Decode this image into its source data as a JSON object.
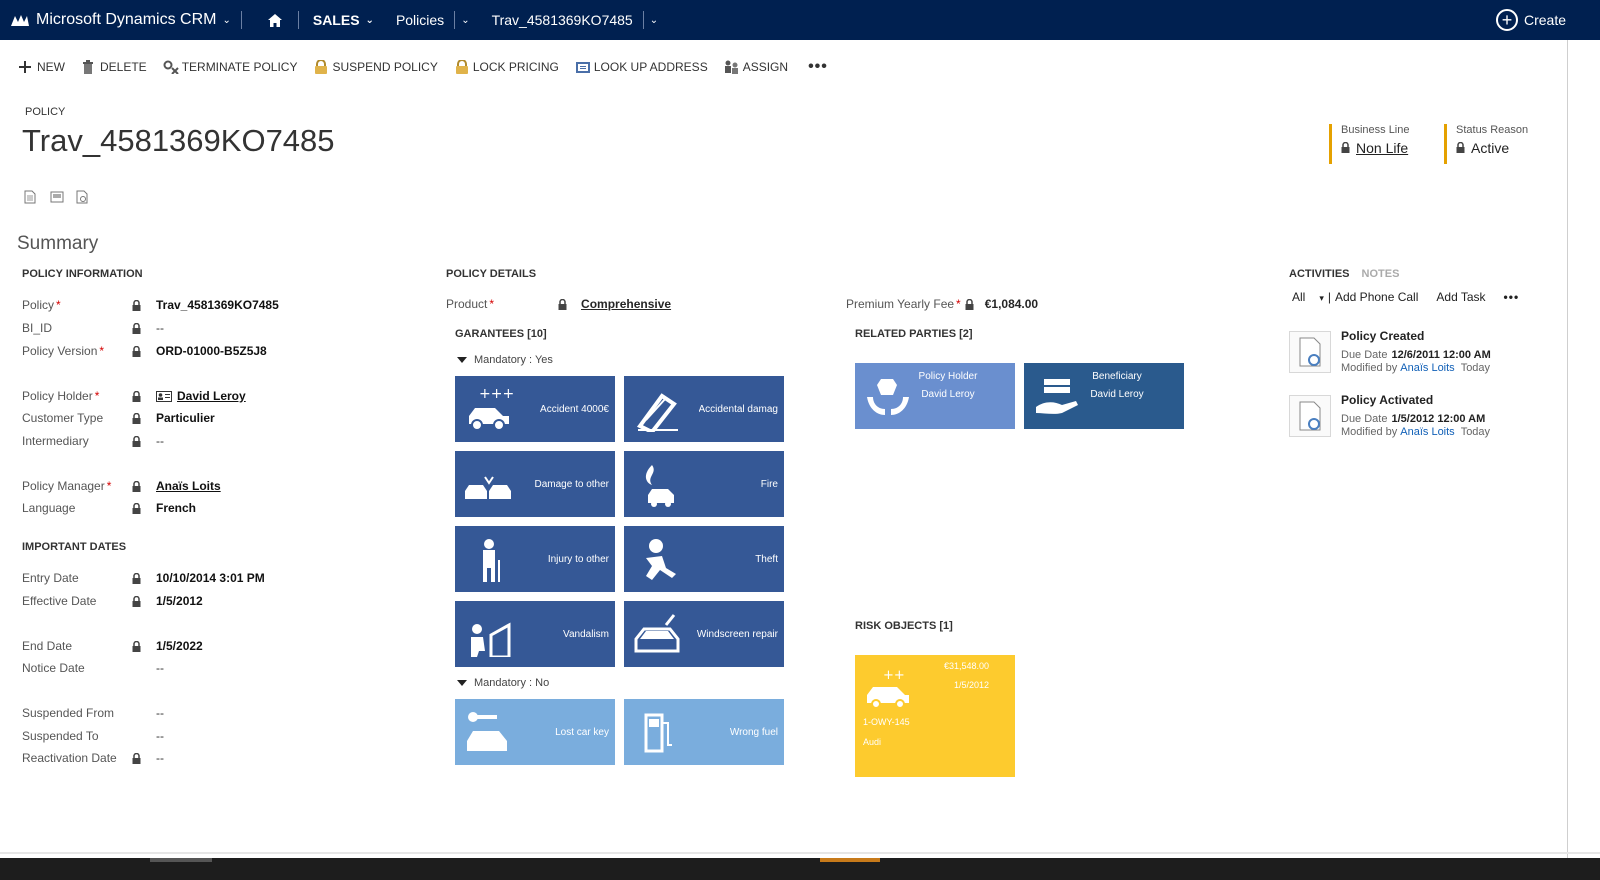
{
  "topnav": {
    "brand": "Microsoft Dynamics CRM",
    "area": "SALES",
    "entity": "Policies",
    "record": "Trav_4581369KO7485",
    "create_label": "Create"
  },
  "commands": [
    {
      "label": "NEW",
      "icon": "plus-icon"
    },
    {
      "label": "DELETE",
      "icon": "trash-icon"
    },
    {
      "label": "TERMINATE POLICY",
      "icon": "terminate-icon"
    },
    {
      "label": "SUSPEND POLICY",
      "icon": "padlock-gold-icon"
    },
    {
      "label": "LOCK PRICING",
      "icon": "padlock-gold-icon"
    },
    {
      "label": "LOOK UP ADDRESS",
      "icon": "address-book-icon"
    },
    {
      "label": "ASSIGN",
      "icon": "assign-icon"
    }
  ],
  "header": {
    "entity_type": "POLICY",
    "title": "Trav_4581369KO7485",
    "business_line_label": "Business Line",
    "business_line_value": "Non Life",
    "status_reason_label": "Status Reason",
    "status_reason_value": "Active"
  },
  "summary_title": "Summary",
  "policy_information": {
    "title": "POLICY INFORMATION",
    "fields": [
      {
        "label": "Policy",
        "required": "*",
        "value": "Trav_4581369KO7485"
      },
      {
        "label": "BI_ID",
        "required": "",
        "value": "--"
      },
      {
        "label": "Policy Version",
        "required": "*",
        "value": "ORD-01000-B5Z5J8"
      },
      {
        "label": "Policy Holder",
        "required": "*",
        "value": "David Leroy"
      },
      {
        "label": "Customer Type",
        "required": "",
        "value": "Particulier"
      },
      {
        "label": "Intermediary",
        "required": "",
        "value": "--"
      },
      {
        "label": "Policy Manager",
        "required": "*",
        "value": "Anaïs Loits"
      },
      {
        "label": "Language",
        "required": "",
        "value": "French"
      }
    ]
  },
  "important_dates": {
    "title": "IMPORTANT DATES",
    "fields": [
      {
        "label": "Entry Date",
        "value": "10/10/2014   3:01 PM"
      },
      {
        "label": "Effective Date",
        "value": "1/5/2012"
      },
      {
        "label": "End Date",
        "value": "1/5/2022"
      },
      {
        "label": "Notice Date",
        "value": "--"
      },
      {
        "label": "Suspended From",
        "value": "--"
      },
      {
        "label": "Suspended To",
        "value": "--"
      },
      {
        "label": "Reactivation Date",
        "value": "--"
      }
    ]
  },
  "policy_details": {
    "title": "POLICY DETAILS",
    "product_label": "Product",
    "product_required": "*",
    "product_value": "Comprehensive",
    "premium_label": "Premium Yearly Fee",
    "premium_required": "*",
    "premium_value": "€1,084.00"
  },
  "guarantees": {
    "title": "GARANTEES [10]",
    "mandatory_yes": "Mandatory : Yes",
    "mandatory_no": "Mandatory : No",
    "tiles": [
      {
        "label": "Accident 4000€",
        "icon": "car-plus-icon",
        "mandatory": true
      },
      {
        "label": "Accidental damag",
        "icon": "accidental-damage-icon",
        "mandatory": true
      },
      {
        "label": "Damage to other",
        "icon": "cars-collision-icon",
        "mandatory": true
      },
      {
        "label": "Fire",
        "icon": "fire-car-icon",
        "mandatory": true
      },
      {
        "label": "Injury to other",
        "icon": "injured-person-icon",
        "mandatory": true
      },
      {
        "label": "Theft",
        "icon": "thief-icon",
        "mandatory": true
      },
      {
        "label": "Vandalism",
        "icon": "vandal-icon",
        "mandatory": true
      },
      {
        "label": "Windscreen repair",
        "icon": "windscreen-icon",
        "mandatory": true
      },
      {
        "label": "Lost car key",
        "icon": "car-key-icon",
        "mandatory": false
      },
      {
        "label": "Wrong fuel",
        "icon": "fuel-pump-icon",
        "mandatory": false
      }
    ]
  },
  "related_parties": {
    "title": "RELATED PARTIES [2]",
    "items": [
      {
        "role": "Policy Holder",
        "name": "David Leroy",
        "icon": "hands-box-icon",
        "color": "#6a8fcf"
      },
      {
        "role": "Beneficiary",
        "name": "David Leroy",
        "icon": "hand-money-icon",
        "color": "#2a5a8d"
      }
    ]
  },
  "risk_objects": {
    "title": "RISK OBJECTS [1]",
    "amount": "€31,548.00",
    "date": "1/5/2012",
    "plate": "1-OWY-145",
    "make": "Audi"
  },
  "activities": {
    "tab_activities": "ACTIVITIES",
    "tab_notes": "NOTES",
    "filter": "All",
    "add_phone_call": "Add Phone Call",
    "add_task": "Add Task",
    "items": [
      {
        "title": "Policy Created",
        "due_label": "Due Date",
        "due": "12/6/2011 12:00 AM",
        "modified_prefix": "Modified by",
        "modified_by": "Anaïs Loits",
        "when": "Today"
      },
      {
        "title": "Policy Activated",
        "due_label": "Due Date",
        "due": "1/5/2012 12:00 AM",
        "modified_prefix": "Modified by",
        "modified_by": "Anaïs Loits",
        "when": "Today"
      }
    ]
  },
  "colors": {
    "nav": "#002050",
    "tile_dark": "#355896",
    "tile_light": "#7aaddd",
    "risk": "#fdcb2e",
    "header_accent": "#e5a100"
  }
}
